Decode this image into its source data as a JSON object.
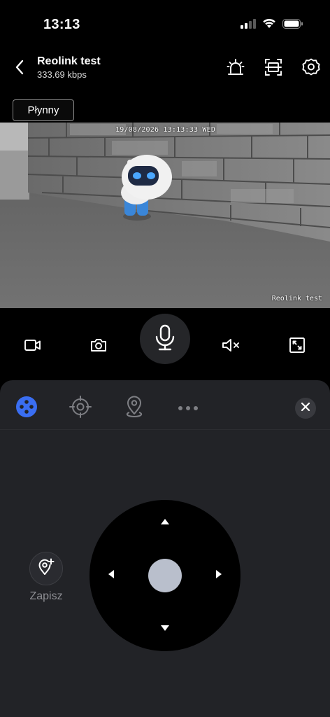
{
  "status_bar": {
    "time": "13:13",
    "icons": [
      "signal-icon",
      "wifi-icon",
      "battery-icon"
    ]
  },
  "header": {
    "title": "Reolink test",
    "bitrate": "333.69 kbps",
    "icons": [
      "back-icon",
      "siren-icon",
      "scan-icon",
      "gear-icon"
    ]
  },
  "quality": {
    "label": "Płynny"
  },
  "video": {
    "timestamp": "19/08/2026 13:13:33 WED",
    "watermark": "Reolink test"
  },
  "controls": {
    "icons": [
      "record-video-icon",
      "snapshot-icon",
      "microphone-icon",
      "speaker-muted-icon",
      "fullscreen-icon"
    ]
  },
  "ptz_panel": {
    "tabs": [
      "ptz-joystick-icon",
      "crosshair-icon",
      "map-pin-icon",
      "more-icon"
    ],
    "active_tab": "ptz-joystick-icon",
    "save_label": "Zapisz",
    "accent_color": "#3a6ef2"
  }
}
